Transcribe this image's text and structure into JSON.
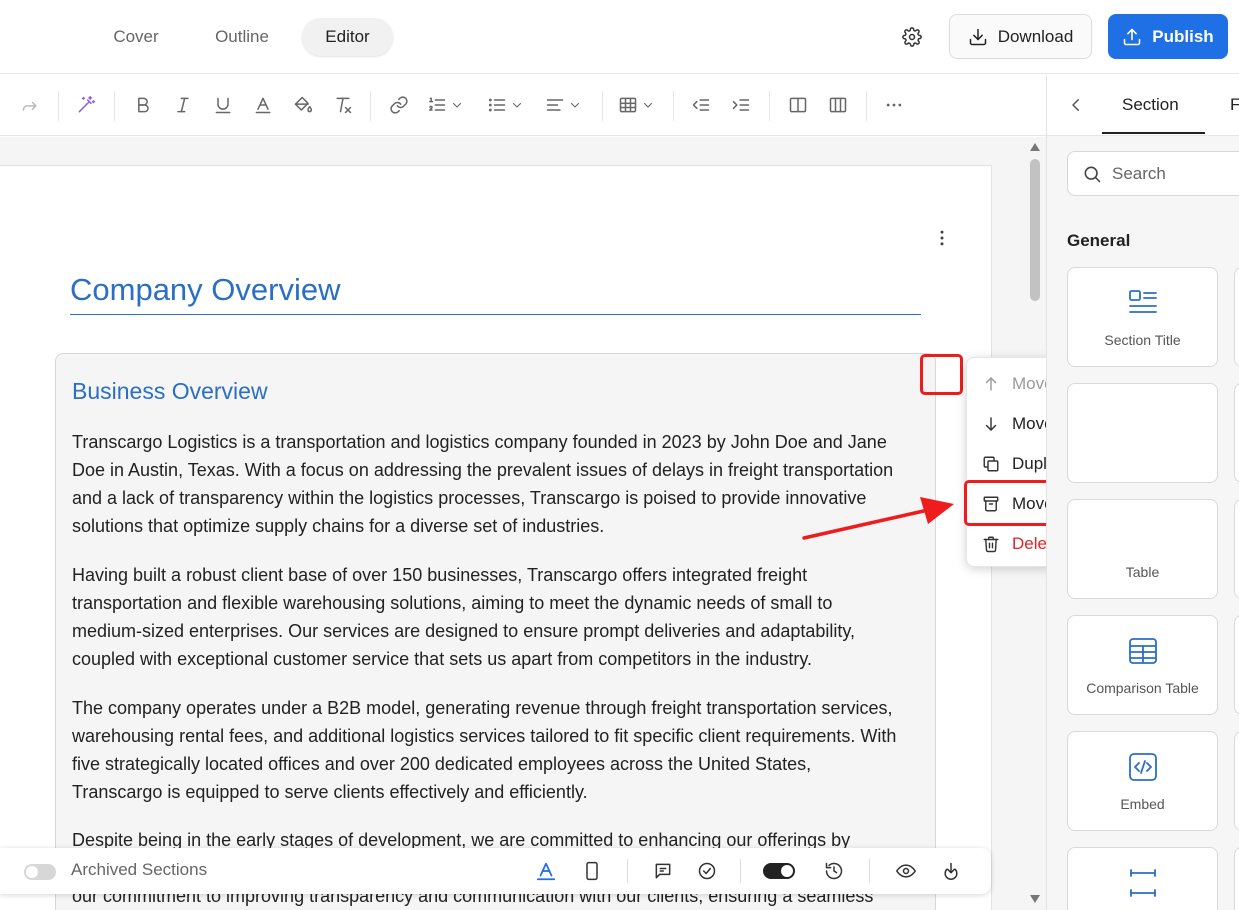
{
  "topbar": {
    "tabs": [
      {
        "label": "Cover",
        "active": false
      },
      {
        "label": "Outline",
        "active": false
      },
      {
        "label": "Editor",
        "active": true
      }
    ],
    "download_label": "Download",
    "publish_label": "Publish",
    "publish_color": "#1f6fe5"
  },
  "toolbar": {
    "icons": [
      "redo-icon",
      "ai-magic-icon",
      "bold-icon",
      "italic-icon",
      "underline-icon",
      "text-color-icon",
      "highlight-icon",
      "clear-format-icon",
      "link-icon",
      "ordered-list-icon",
      "bullet-list-icon",
      "align-icon",
      "table-icon",
      "outdent-icon",
      "indent-icon",
      "column-icon",
      "columns-icon",
      "more-icon"
    ]
  },
  "document": {
    "title": "Company Overview",
    "section": {
      "heading": "Business Overview",
      "paragraphs": [
        "Transcargo Logistics is a transportation and logistics company founded in 2023 by John Doe and Jane Doe in Austin, Texas. With a focus on addressing the prevalent issues of delays in freight transportation and a lack of transparency within the logistics processes, Transcargo is poised to provide innovative solutions that optimize supply chains for a diverse set of industries.",
        "Having built a robust client base of over 150 businesses, Transcargo offers integrated freight transportation and flexible warehousing solutions, aiming to meet the dynamic needs of small to medium-sized enterprises. Our services are designed to ensure prompt deliveries and adaptability, coupled with exceptional customer service that sets us apart from competitors in the industry.",
        "The company operates under a B2B model, generating revenue through freight transportation services, warehousing rental fees, and additional logistics services tailored to fit specific client requirements. With five strategically located offices and over 200 dedicated employees across the United States, Transcargo is equipped to serve clients effectively and efficiently.",
        "Despite being in the early stages of development, we are committed to enhancing our offerings by",
        "our commitment to improving transparency and communication with our clients, ensuring a seamless"
      ]
    }
  },
  "context_menu": {
    "items": [
      {
        "label": "Move Up",
        "icon": "arrow-up-icon",
        "state": "disabled"
      },
      {
        "label": "Move Down",
        "icon": "arrow-down-icon",
        "state": "normal"
      },
      {
        "label": "Duplicate",
        "icon": "duplicate-icon",
        "state": "normal"
      },
      {
        "label": "Move to Archive",
        "icon": "archive-icon",
        "state": "highlighted"
      },
      {
        "label": "Delete",
        "icon": "trash-icon",
        "state": "danger"
      }
    ],
    "danger_color": "#e02424"
  },
  "bottombar": {
    "archived_label": "Archived Sections",
    "archived_toggle_on": false,
    "mode_toggle_on": true
  },
  "right_panel": {
    "tabs": [
      "Section",
      "F"
    ],
    "search_placeholder": "Search",
    "group_label": "General",
    "blocks": [
      {
        "label": "Section Title",
        "icon": "section-title-icon"
      },
      {
        "label": "",
        "icon": ""
      },
      {
        "label": "Table",
        "icon": "table-icon"
      },
      {
        "label": "Comparison Table",
        "icon": "comparison-table-icon"
      },
      {
        "label": "Embed",
        "icon": "embed-icon"
      },
      {
        "label": "",
        "icon": "divider-icon"
      }
    ]
  },
  "annotation_color": "#ee1c1c"
}
